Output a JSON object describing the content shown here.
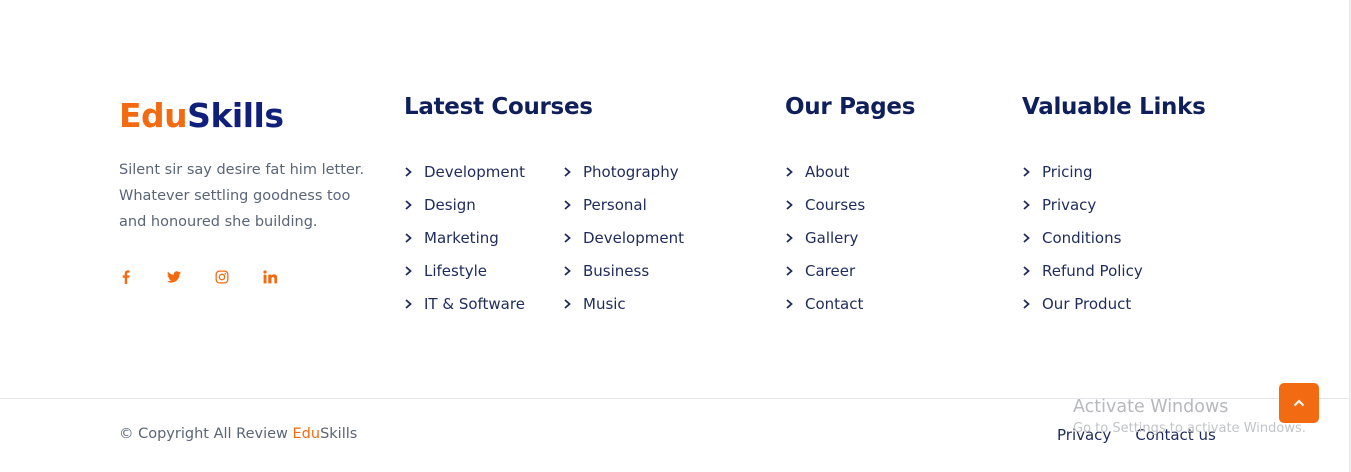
{
  "brand": {
    "part1": "Edu",
    "part2": "Skills",
    "accent_color": "#f26b12",
    "primary_color": "#10207a"
  },
  "about_text": "Silent sir say desire fat him letter. Whatever settling goodness too and honoured she building.",
  "social": [
    {
      "icon": "facebook-icon"
    },
    {
      "icon": "twitter-icon"
    },
    {
      "icon": "instagram-icon"
    },
    {
      "icon": "linkedin-icon"
    }
  ],
  "latest_courses": {
    "heading": "Latest Courses",
    "col1": [
      "Development",
      "Design",
      "Marketing",
      "Lifestyle",
      "IT & Software"
    ],
    "col2": [
      "Photography",
      "Personal",
      "Development",
      "Business",
      "Music"
    ]
  },
  "our_pages": {
    "heading": "Our Pages",
    "items": [
      "About",
      "Courses",
      "Gallery",
      "Career",
      "Contact"
    ]
  },
  "valuable_links": {
    "heading": "Valuable Links",
    "items": [
      "Pricing",
      "Privacy",
      "Conditions",
      "Refund Policy",
      "Our Product"
    ]
  },
  "footer_bottom": {
    "copyright_prefix": "© Copyright All Review ",
    "brand_part1": "Edu",
    "brand_part2": "Skills",
    "privacy_label": "Privacy",
    "contact_label": "Contact us"
  },
  "watermark": {
    "line1": "Activate Windows",
    "line2": "Go to Settings to activate Windows."
  },
  "scroll_top_icon": "chevron-up-icon"
}
